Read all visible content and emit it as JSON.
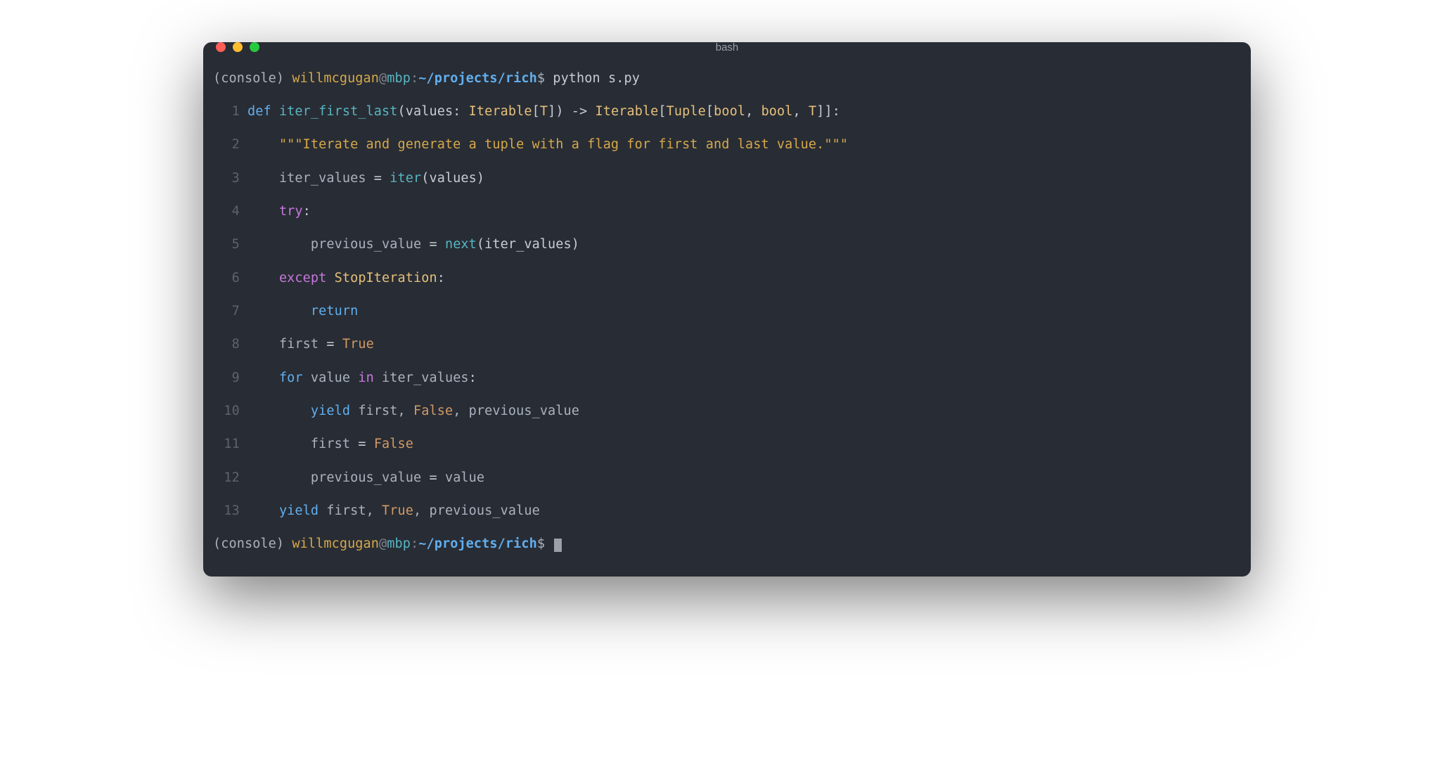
{
  "window": {
    "title": "bash"
  },
  "prompt1": {
    "env": "(console)",
    "user": "willmcgugan",
    "at": "@",
    "host": "mbp",
    "colon": ":",
    "path": "~/projects/rich",
    "symbol": "$",
    "command": "python s.py"
  },
  "prompt2": {
    "env": "(console)",
    "user": "willmcgugan",
    "at": "@",
    "host": "mbp",
    "colon": ":",
    "path": "~/projects/rich",
    "symbol": "$"
  },
  "code": {
    "l1": {
      "n": "1",
      "def": "def ",
      "fn": "iter_first_last",
      "p1": "(values: ",
      "t1": "Iterable",
      "b1": "[",
      "t2": "T",
      "b2": "]) ",
      "arrow": "-> ",
      "t3": "Iterable",
      "b3": "[",
      "t4": "Tuple",
      "b4": "[",
      "t5": "bool",
      "c1": ", ",
      "t6": "bool",
      "c2": ", ",
      "t7": "T",
      "b5": "]]:"
    },
    "l2": {
      "n": "2",
      "indent": "    ",
      "doc": "\"\"\"Iterate and generate a tuple with a flag for first and last value.\"\"\""
    },
    "l3": {
      "n": "3",
      "indent": "    ",
      "a": "iter_values ",
      "eq": "= ",
      "fn": "iter",
      "p": "(values)"
    },
    "l4": {
      "n": "4",
      "indent": "    ",
      "kw": "try",
      "colon": ":"
    },
    "l5": {
      "n": "5",
      "indent": "        ",
      "a": "previous_value ",
      "eq": "= ",
      "fn": "next",
      "p": "(iter_values)"
    },
    "l6": {
      "n": "6",
      "indent": "    ",
      "kw": "except ",
      "exc": "StopIteration",
      "colon": ":"
    },
    "l7": {
      "n": "7",
      "indent": "        ",
      "kw": "return"
    },
    "l8": {
      "n": "8",
      "indent": "    ",
      "a": "first ",
      "eq": "= ",
      "v": "True"
    },
    "l9": {
      "n": "9",
      "indent": "    ",
      "kw": "for ",
      "a": "value ",
      "in": "in ",
      "b": "iter_values",
      "colon": ":"
    },
    "l10": {
      "n": "10",
      "indent": "        ",
      "kw": "yield ",
      "a": "first, ",
      "v": "False",
      "b": ", previous_value"
    },
    "l11": {
      "n": "11",
      "indent": "        ",
      "a": "first ",
      "eq": "= ",
      "v": "False"
    },
    "l12": {
      "n": "12",
      "indent": "        ",
      "a": "previous_value ",
      "eq": "= ",
      "b": "value"
    },
    "l13": {
      "n": "13",
      "indent": "    ",
      "kw": "yield ",
      "a": "first, ",
      "v": "True",
      "b": ", previous_value"
    }
  },
  "colors": {
    "background": "#282c34",
    "keyword_blue": "#61afef",
    "keyword_purple": "#c678dd",
    "function_cyan": "#56b6c2",
    "string_yellow": "#d6a94b",
    "type_gold": "#e5c07b",
    "constant_orange": "#d19a66",
    "linenum_gray": "#5c6370"
  }
}
